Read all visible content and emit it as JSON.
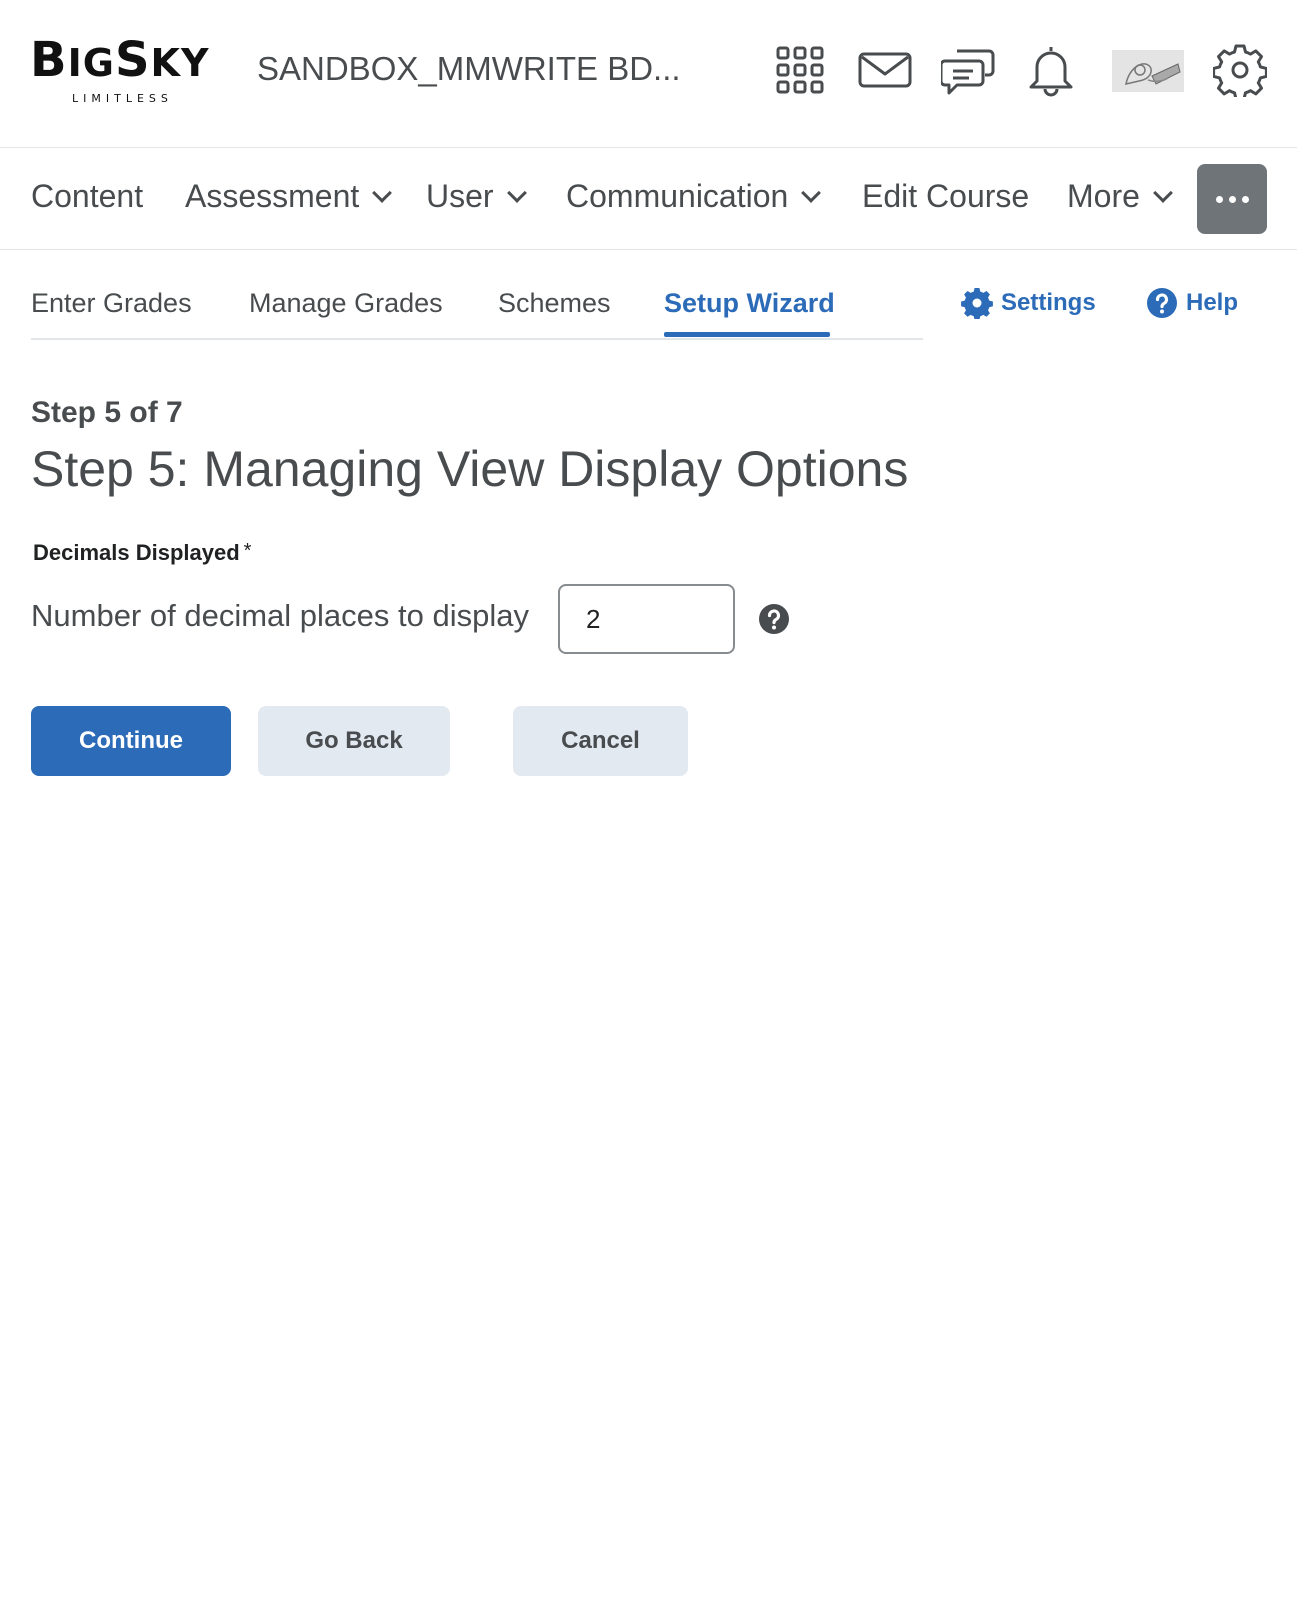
{
  "header": {
    "logo_main_1": "B",
    "logo_main_2": "IG",
    "logo_main_3": "S",
    "logo_main_4": "KY",
    "logo_sub": "LIMITLESS",
    "course_title": "SANDBOX_MMWRITE BD...",
    "icons": [
      "apps-grid-icon",
      "mail-icon",
      "chat-icon",
      "bell-icon",
      "avatar",
      "gear-icon"
    ]
  },
  "nav": {
    "items": [
      {
        "label": "Content",
        "dropdown": false
      },
      {
        "label": "Assessment",
        "dropdown": true
      },
      {
        "label": "User",
        "dropdown": true
      },
      {
        "label": "Communication",
        "dropdown": true
      },
      {
        "label": "Edit Course",
        "dropdown": false
      },
      {
        "label": "More",
        "dropdown": true
      }
    ],
    "overflow_icon": "ellipsis-icon"
  },
  "tabs": {
    "items": [
      {
        "label": "Enter Grades"
      },
      {
        "label": "Manage Grades"
      },
      {
        "label": "Schemes"
      },
      {
        "label": "Setup Wizard",
        "active": true
      }
    ],
    "settings_label": "Settings",
    "help_label": "Help"
  },
  "content": {
    "step_counter": "Step 5 of 7",
    "step_title": "Step 5: Managing View Display Options",
    "field_label": "Decimals Displayed",
    "required_marker": "*",
    "field_prompt": "Number of decimal places to display",
    "field_value": "2"
  },
  "buttons": {
    "continue": "Continue",
    "go_back": "Go Back",
    "cancel": "Cancel"
  },
  "colors": {
    "accent": "#2c6bb8",
    "text": "#494c4e",
    "secondary_button": "#e3e9f1",
    "overflow_button": "#6e7477"
  }
}
